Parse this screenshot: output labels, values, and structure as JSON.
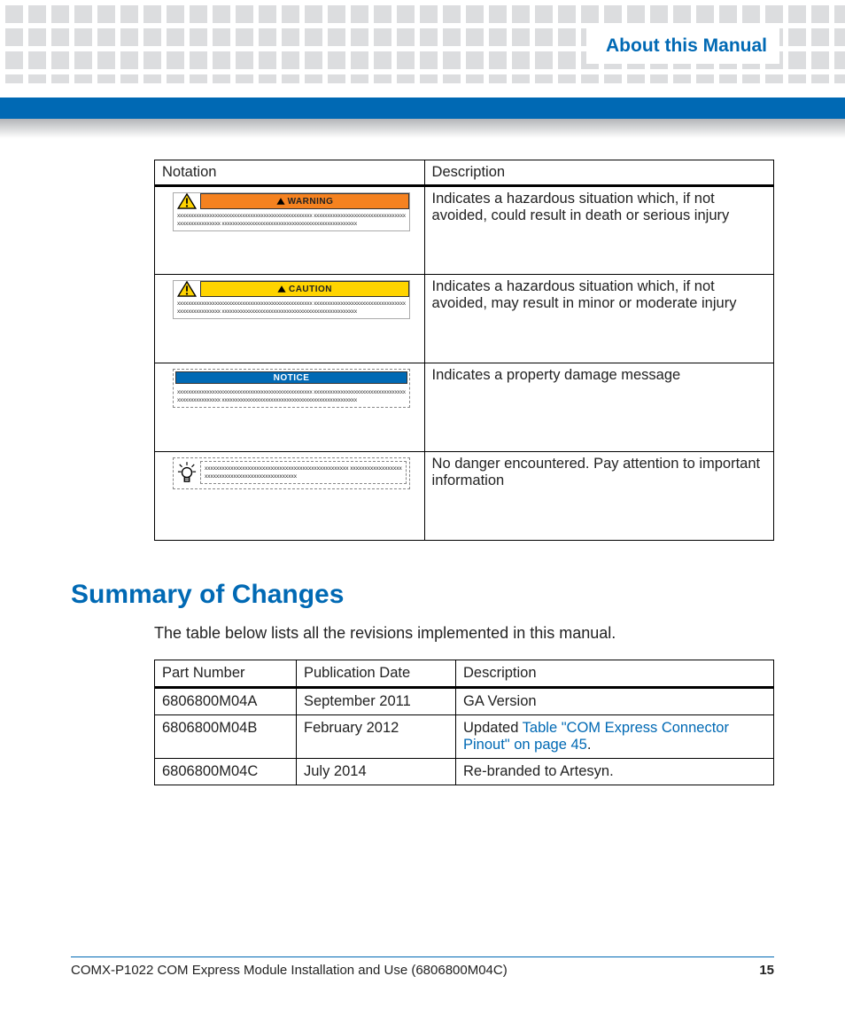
{
  "header": {
    "title": "About this Manual"
  },
  "notation_table": {
    "headers": [
      "Notation",
      "Description"
    ],
    "rows": [
      {
        "box_type": "warning",
        "box_label": "WARNING",
        "placeholder": "xxxxxxxxxxxxxxxxxxxxxxxxxxxxxxxxxxxxxxxxxxxxxxxxxx xxxxxxxxxxxxxxxxxxxxxxxxxxxxxxxxxxxxxxxxxxxxxxxxxx xxxxxxxxxxxxxxxxxxxxxxxxxxxxxxxxxxxxxxxxxxxxxxxxxx",
        "description": "Indicates a hazardous situation which, if not avoided, could result in death or serious injury"
      },
      {
        "box_type": "caution",
        "box_label": "CAUTION",
        "placeholder": "xxxxxxxxxxxxxxxxxxxxxxxxxxxxxxxxxxxxxxxxxxxxxxxxxx xxxxxxxxxxxxxxxxxxxxxxxxxxxxxxxxxxxxxxxxxxxxxxxxxx xxxxxxxxxxxxxxxxxxxxxxxxxxxxxxxxxxxxxxxxxxxxxxxxxx",
        "description": "Indicates a hazardous situation which, if not avoided, may result in minor or moderate injury"
      },
      {
        "box_type": "notice",
        "box_label": "NOTICE",
        "placeholder": "xxxxxxxxxxxxxxxxxxxxxxxxxxxxxxxxxxxxxxxxxxxxxxxxxx xxxxxxxxxxxxxxxxxxxxxxxxxxxxxxxxxxxxxxxxxxxxxxxxxx xxxxxxxxxxxxxxxxxxxxxxxxxxxxxxxxxxxxxxxxxxxxxxxxxx",
        "description": "Indicates a property damage message"
      },
      {
        "box_type": "info",
        "box_label": "",
        "placeholder": "xxxxxxxxxxxxxxxxxxxxxxxxxxxxxxxxxxxxxxxxxxxxxxxxxx xxxxxxxxxxxxxxxxxxxxxxxxxxxxxxxxxxxxxxxxxxxxxxxxxx",
        "description": "No danger encountered. Pay attention to important information"
      }
    ]
  },
  "section": {
    "heading": "Summary of Changes",
    "intro": "The table below lists all the revisions implemented in this manual."
  },
  "changes_table": {
    "headers": [
      "Part Number",
      "Publication Date",
      "Description"
    ],
    "rows": [
      {
        "part": "6806800M04A",
        "date": "September 2011",
        "desc_prefix": "GA Version",
        "link": "",
        "desc_suffix": ""
      },
      {
        "part": "6806800M04B",
        "date": "February 2012",
        "desc_prefix": "Updated ",
        "link": "Table \"COM Express Connector Pinout\" on page 45",
        "desc_suffix": "."
      },
      {
        "part": "6806800M04C",
        "date": "July 2014",
        "desc_prefix": "Re-branded to Artesyn.",
        "link": "",
        "desc_suffix": ""
      }
    ]
  },
  "footer": {
    "left": "COMX-P1022 COM Express Module Installation and Use (6806800M04C)",
    "right": "15"
  }
}
